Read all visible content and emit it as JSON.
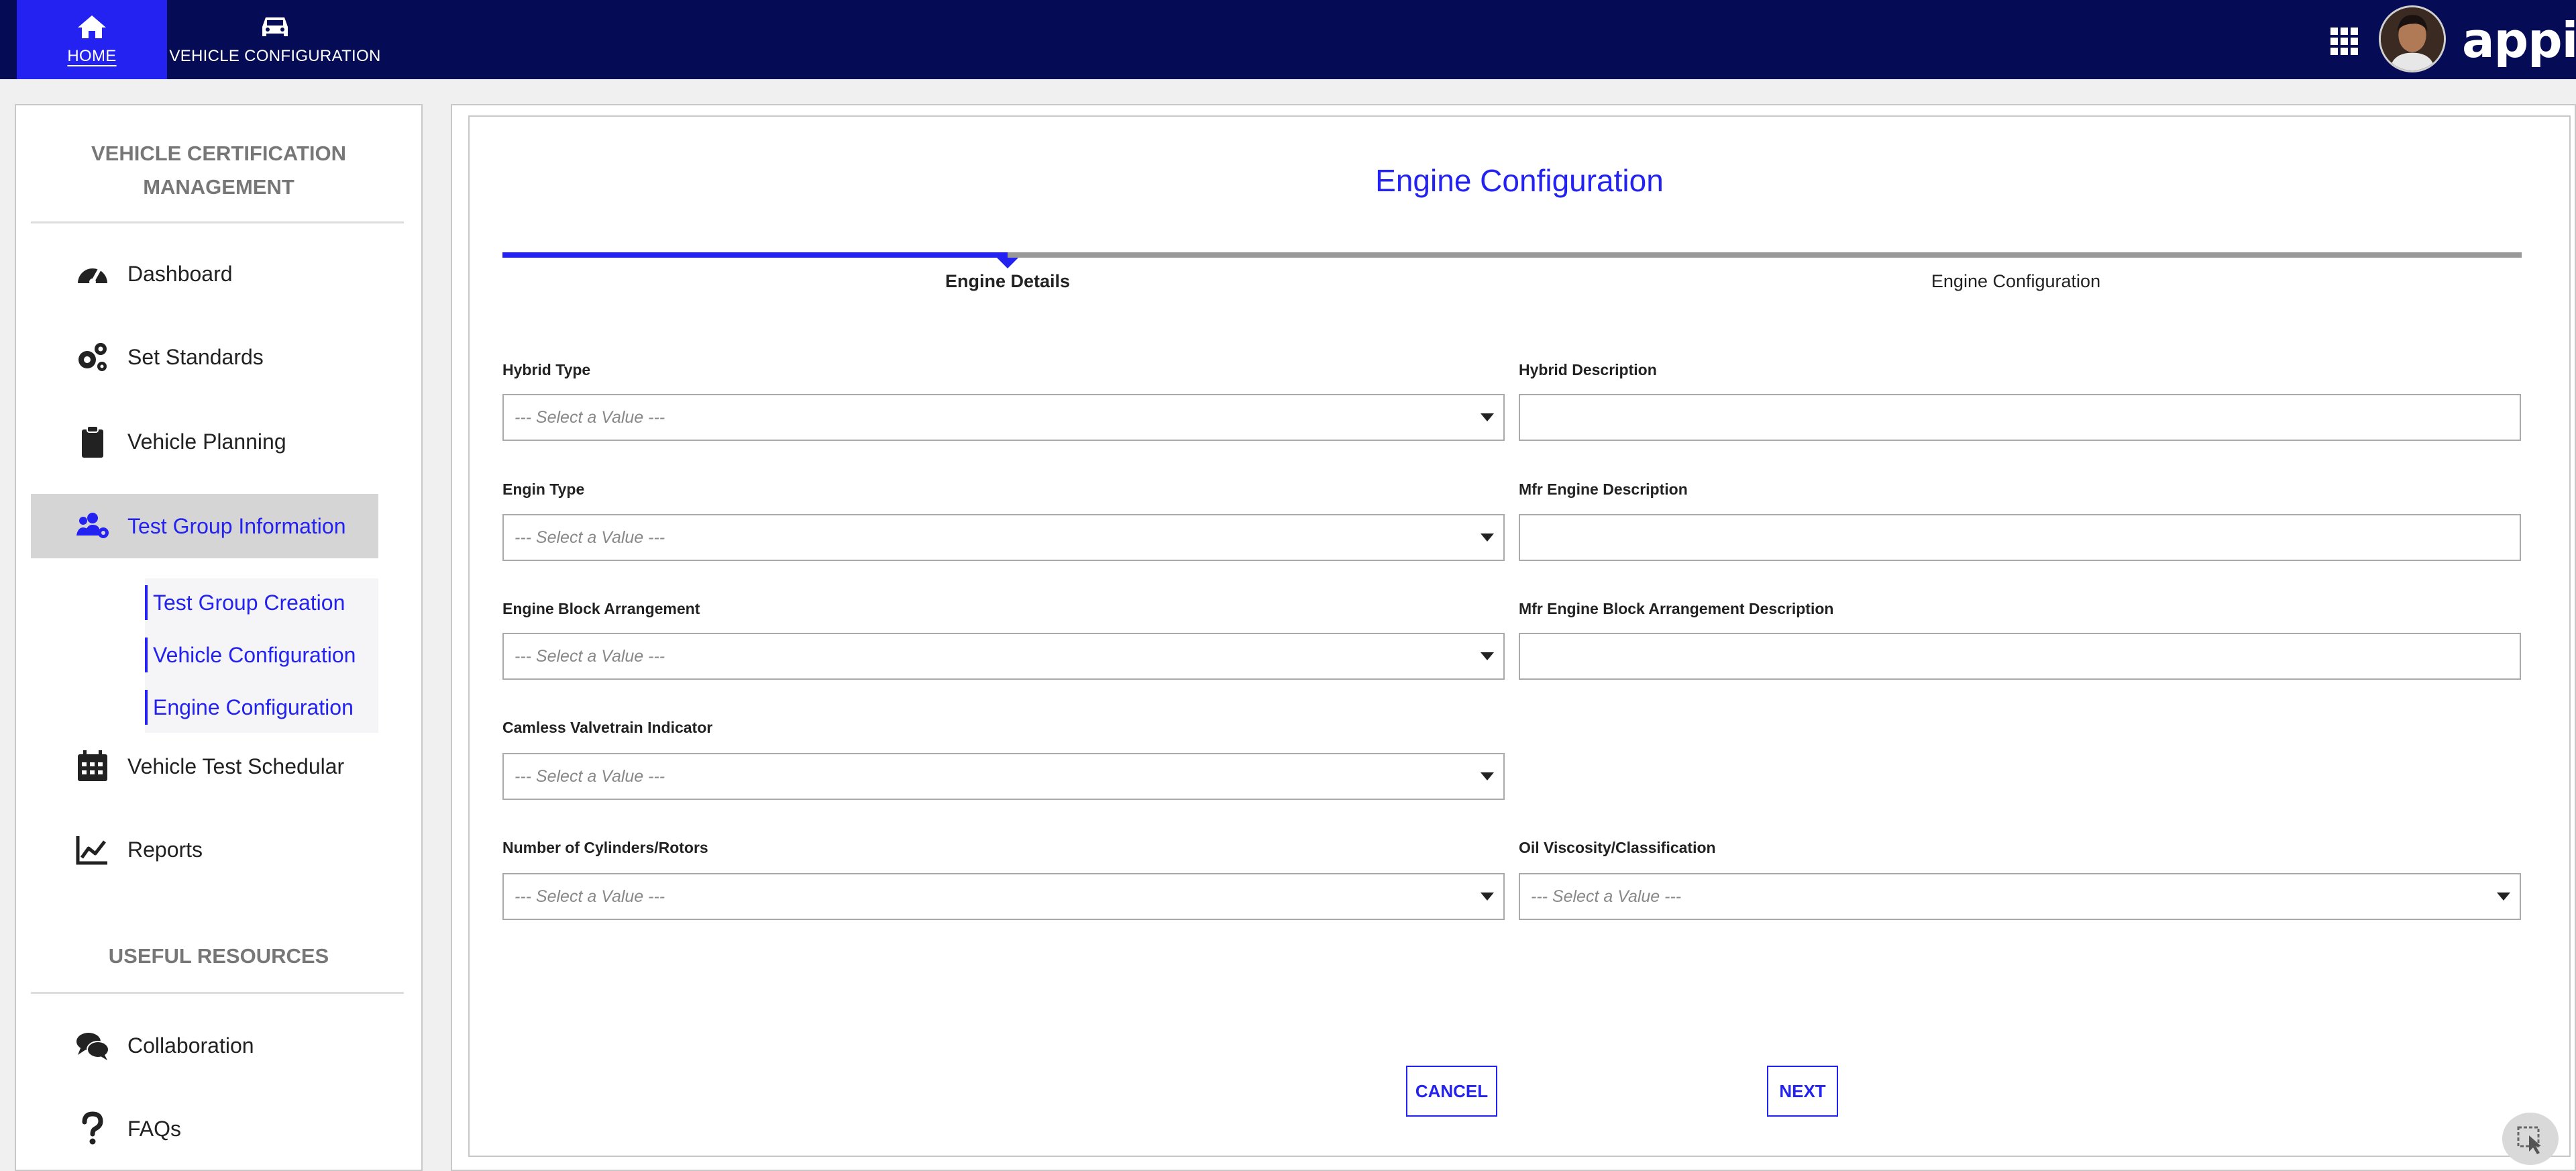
{
  "topnav": {
    "tabs": [
      {
        "label": "HOME",
        "icon": "home-icon"
      },
      {
        "label": "VEHICLE CONFIGURATION",
        "icon": "car-icon"
      }
    ],
    "brand": "appian"
  },
  "sidebar": {
    "title": "VEHICLE CERTIFICATION MANAGEMENT",
    "items": [
      {
        "label": "Dashboard",
        "icon": "speedometer-icon"
      },
      {
        "label": "Set Standards",
        "icon": "gears-icon"
      },
      {
        "label": "Vehicle Planning",
        "icon": "clipboard-icon"
      },
      {
        "label": "Test Group Information",
        "icon": "users-gear-icon",
        "active": true
      },
      {
        "label": "Vehicle Test Schedular",
        "icon": "calendar-icon"
      },
      {
        "label": "Reports",
        "icon": "line-chart-icon"
      }
    ],
    "sub_items": [
      {
        "label": "Test Group Creation"
      },
      {
        "label": "Vehicle Configuration"
      },
      {
        "label": "Engine Configuration"
      }
    ],
    "resources_title": "USEFUL RESOURCES",
    "resources": [
      {
        "label": "Collaboration",
        "icon": "chat-icon"
      },
      {
        "label": "FAQs",
        "icon": "question-icon"
      }
    ]
  },
  "main": {
    "title": "Engine Configuration",
    "steps": [
      {
        "label": "Engine Details",
        "active": true
      },
      {
        "label": "Engine Configuration",
        "active": false
      }
    ],
    "placeholder": "--- Select a Value ---",
    "fields": {
      "hybrid_type": {
        "label": "Hybrid Type"
      },
      "hybrid_description": {
        "label": "Hybrid Description",
        "value": ""
      },
      "engin_type": {
        "label": "Engin Type"
      },
      "mfr_engine_description": {
        "label": "Mfr Engine Description",
        "value": ""
      },
      "engine_block_arrangement": {
        "label": "Engine Block Arrangement"
      },
      "mfr_engine_block_desc": {
        "label": "Mfr Engine Block Arrangement Description",
        "value": ""
      },
      "camless_valvetrain": {
        "label": "Camless Valvetrain Indicator"
      },
      "cylinders_rotors": {
        "label": "Number of Cylinders/Rotors"
      },
      "oil_viscosity": {
        "label": "Oil Viscosity/Classification"
      }
    },
    "buttons": {
      "cancel": "CANCEL",
      "next": "NEXT"
    }
  },
  "colors": {
    "topbar": "#050c55",
    "accent": "#2322f0",
    "active_item_bg": "#d5d5d5"
  }
}
